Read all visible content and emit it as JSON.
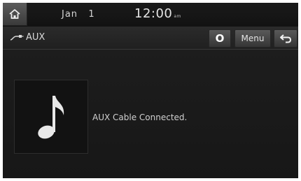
{
  "status_bar": {
    "date": "Jan   1",
    "time": "12:00",
    "ampm": "am"
  },
  "title_bar": {
    "source_label": "AUX",
    "o_button_label": "O",
    "menu_label": "Menu"
  },
  "content": {
    "message": "AUX Cable Connected."
  },
  "icons": {
    "home": "home-icon",
    "source": "aux-cable-icon",
    "back": "back-arrow-icon",
    "album_art": "music-note-icon"
  }
}
